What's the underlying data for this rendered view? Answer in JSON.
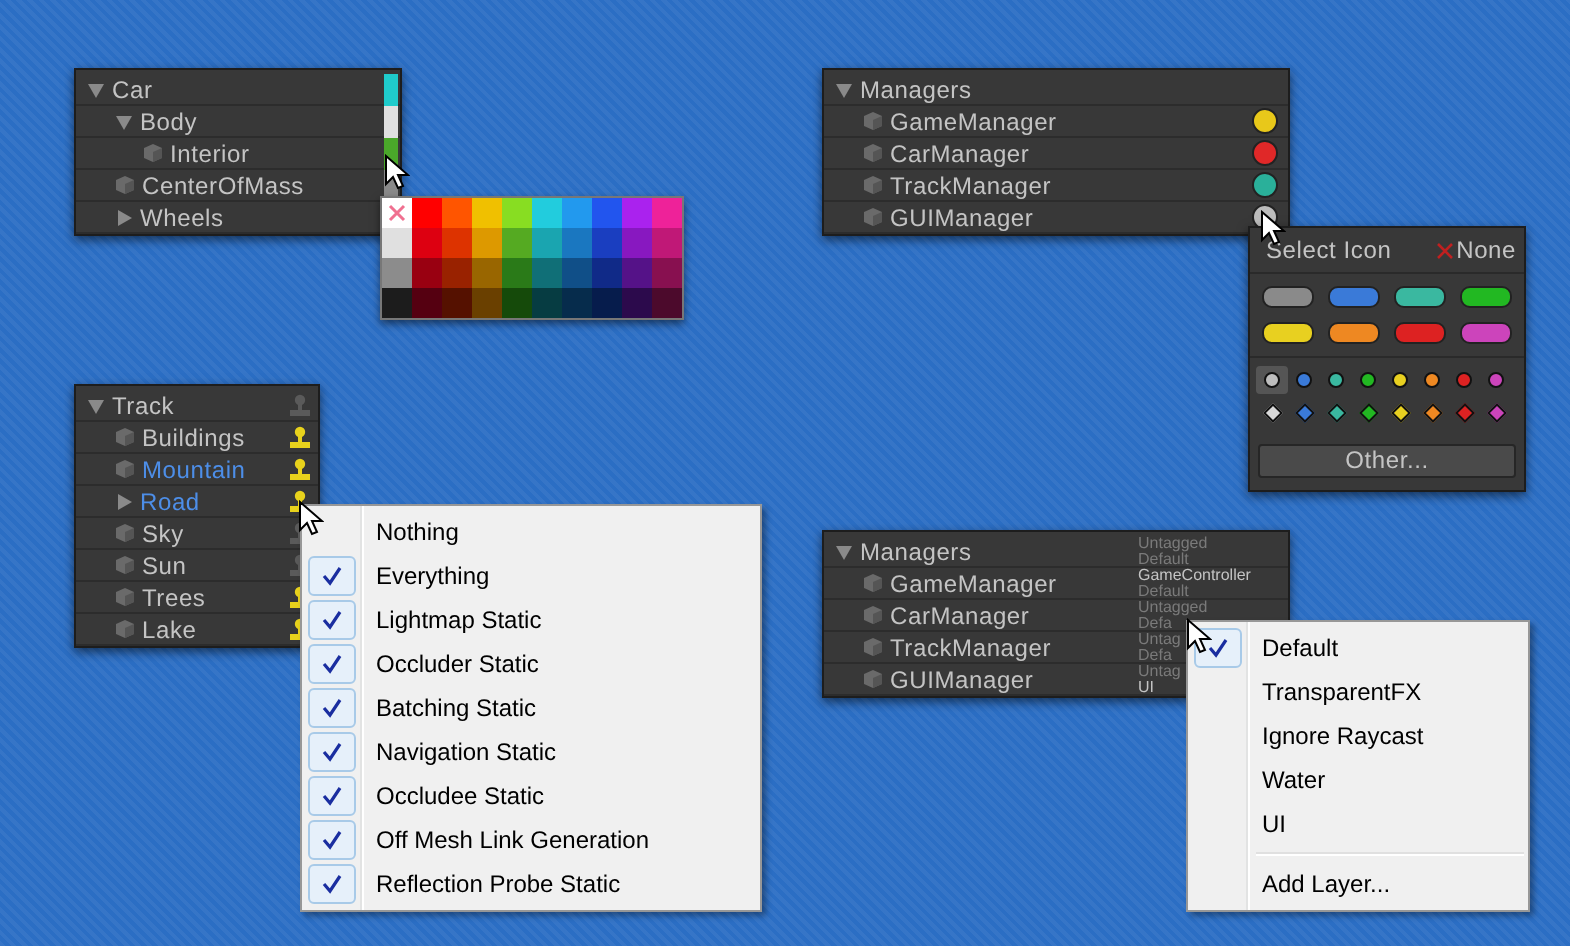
{
  "car_hierarchy": {
    "rows": [
      {
        "label": "Car",
        "expanded": true,
        "color": "#1fcccc",
        "children": [
          {
            "label": "Body",
            "expanded": true,
            "color": "#e0e0e0",
            "children": [
              {
                "label": "Interior",
                "color": "#4aa82a"
              }
            ]
          },
          {
            "label": "CenterOfMass",
            "color": "#8a8a8a"
          },
          {
            "label": "Wheels",
            "expanded": false
          }
        ]
      }
    ]
  },
  "color_palette": {
    "swatches": [
      {
        "kind": "none",
        "color": "#ffffff"
      },
      {
        "kind": "color",
        "color": "#ff0000"
      },
      {
        "kind": "color",
        "color": "#ff5500"
      },
      {
        "kind": "color",
        "color": "#f0c000"
      },
      {
        "kind": "color",
        "color": "#88dd22"
      },
      {
        "kind": "color",
        "color": "#22ccdd"
      },
      {
        "kind": "color",
        "color": "#2299ee"
      },
      {
        "kind": "color",
        "color": "#2255ee"
      },
      {
        "kind": "color",
        "color": "#aa22ee"
      },
      {
        "kind": "color",
        "color": "#ee2299"
      },
      {
        "kind": "color",
        "color": "#e0e0e0"
      },
      {
        "kind": "color",
        "color": "#dd0011"
      },
      {
        "kind": "color",
        "color": "#dd3300"
      },
      {
        "kind": "color",
        "color": "#dd9900"
      },
      {
        "kind": "color",
        "color": "#55aa22"
      },
      {
        "kind": "color",
        "color": "#1aa5b0"
      },
      {
        "kind": "color",
        "color": "#1a77c0"
      },
      {
        "kind": "color",
        "color": "#1a3ec0"
      },
      {
        "kind": "color",
        "color": "#8818c0"
      },
      {
        "kind": "color",
        "color": "#c01877"
      },
      {
        "kind": "color",
        "color": "#8c8c8c"
      },
      {
        "kind": "color",
        "color": "#990011"
      },
      {
        "kind": "color",
        "color": "#992200"
      },
      {
        "kind": "color",
        "color": "#996600"
      },
      {
        "kind": "color",
        "color": "#2a7a18"
      },
      {
        "kind": "color",
        "color": "#106f77"
      },
      {
        "kind": "color",
        "color": "#104f88"
      },
      {
        "kind": "color",
        "color": "#102a88"
      },
      {
        "kind": "color",
        "color": "#551288"
      },
      {
        "kind": "color",
        "color": "#881050"
      },
      {
        "kind": "color",
        "color": "#1c1c1c"
      },
      {
        "kind": "color",
        "color": "#550011"
      },
      {
        "kind": "color",
        "color": "#551100"
      },
      {
        "kind": "color",
        "color": "#6a4000"
      },
      {
        "kind": "color",
        "color": "#154a0a"
      },
      {
        "kind": "color",
        "color": "#063c42"
      },
      {
        "kind": "color",
        "color": "#062c4c"
      },
      {
        "kind": "color",
        "color": "#061c4c"
      },
      {
        "kind": "color",
        "color": "#2c0a4c"
      },
      {
        "kind": "color",
        "color": "#4c0a2c"
      }
    ]
  },
  "managers_hierarchy": {
    "rows": [
      {
        "label": "Managers",
        "expanded": true,
        "children": [
          {
            "label": "GameManager",
            "color": "#e8c81a"
          },
          {
            "label": "CarManager",
            "color": "#e02828"
          },
          {
            "label": "TrackManager",
            "color": "#2ab09a"
          },
          {
            "label": "GUIManager",
            "color": "#bcbcbc"
          }
        ]
      }
    ]
  },
  "icon_picker": {
    "title": "Select Icon",
    "none_label": "None",
    "labels": [
      {
        "color": "#8a8a8a"
      },
      {
        "color": "#3a7ad8"
      },
      {
        "color": "#3ab8a0"
      },
      {
        "color": "#22b822"
      },
      {
        "color": "#e8d020"
      },
      {
        "color": "#ee8822"
      },
      {
        "color": "#dd2222"
      },
      {
        "color": "#cc44bb"
      }
    ],
    "dots": [
      {
        "color": "#bdbdbd",
        "selected": true
      },
      {
        "color": "#3a7ad8",
        "selected": false
      },
      {
        "color": "#3ab8a0",
        "selected": false
      },
      {
        "color": "#22b822",
        "selected": false
      },
      {
        "color": "#e8d020",
        "selected": false
      },
      {
        "color": "#ee8822",
        "selected": false
      },
      {
        "color": "#dd2222",
        "selected": false
      },
      {
        "color": "#cc44bb",
        "selected": false
      }
    ],
    "diamonds": [
      {
        "color": "#d8d8d8",
        "selected": false
      },
      {
        "color": "#3a7ad8",
        "selected": false
      },
      {
        "color": "#3ab8a0",
        "selected": false
      },
      {
        "color": "#22b822",
        "selected": false
      },
      {
        "color": "#e8d020",
        "selected": false
      },
      {
        "color": "#ee8822",
        "selected": false
      },
      {
        "color": "#dd2222",
        "selected": false
      },
      {
        "color": "#cc44bb",
        "selected": false
      }
    ],
    "button": "Other..."
  },
  "track_hierarchy": {
    "rows": [
      {
        "label": "Track",
        "expanded": true,
        "static": false,
        "prefab": false,
        "children": [
          {
            "label": "Buildings",
            "static": true,
            "prefab": false
          },
          {
            "label": "Mountain",
            "static": true,
            "prefab": true
          },
          {
            "label": "Road",
            "expanded": false,
            "static": true,
            "prefab": true
          },
          {
            "label": "Sky",
            "static": false,
            "prefab": false
          },
          {
            "label": "Sun",
            "static": false,
            "prefab": false
          },
          {
            "label": "Trees",
            "static": true,
            "prefab": false
          },
          {
            "label": "Lake",
            "static": true,
            "prefab": false
          }
        ]
      }
    ]
  },
  "static_flags_menu": {
    "items": [
      {
        "label": "Nothing",
        "kind": "option",
        "checked": false
      },
      {
        "label": "Everything",
        "kind": "option",
        "checked": true
      },
      {
        "label": "Lightmap Static",
        "kind": "option",
        "checked": true
      },
      {
        "label": "Occluder Static",
        "kind": "option",
        "checked": true
      },
      {
        "label": "Batching Static",
        "kind": "option",
        "checked": true
      },
      {
        "label": "Navigation Static",
        "kind": "option",
        "checked": true
      },
      {
        "label": "Occludee Static",
        "kind": "option",
        "checked": true
      },
      {
        "label": "Off Mesh Link Generation",
        "kind": "option",
        "checked": true
      },
      {
        "label": "Reflection Probe Static",
        "kind": "option",
        "checked": true
      }
    ]
  },
  "tags_layers_hierarchy": {
    "rows": [
      {
        "label": "Managers",
        "expanded": true,
        "tag": "Untagged",
        "tag_default": true,
        "layer": "Default",
        "layer_default": true,
        "children": [
          {
            "label": "GameManager",
            "tag": "GameController",
            "tag_default": false,
            "layer": "Default",
            "layer_default": true
          },
          {
            "label": "CarManager",
            "tag": "Untagged",
            "tag_default": true,
            "layer": "Defa",
            "layer_default": true
          },
          {
            "label": "TrackManager",
            "tag": "Untag",
            "tag_default": true,
            "layer": "Defa",
            "layer_default": true
          },
          {
            "label": "GUIManager",
            "tag": "Untag",
            "tag_default": true,
            "layer": "UI",
            "layer_default": false
          }
        ]
      }
    ]
  },
  "layer_menu": {
    "items": [
      {
        "label": "Default",
        "kind": "option",
        "checked": true
      },
      {
        "label": "TransparentFX",
        "kind": "option",
        "checked": false
      },
      {
        "label": "Ignore Raycast",
        "kind": "option",
        "checked": false
      },
      {
        "label": "Water",
        "kind": "option",
        "checked": false
      },
      {
        "label": "UI",
        "kind": "option",
        "checked": false
      },
      {
        "label": "Add Layer...",
        "kind": "action"
      }
    ]
  }
}
